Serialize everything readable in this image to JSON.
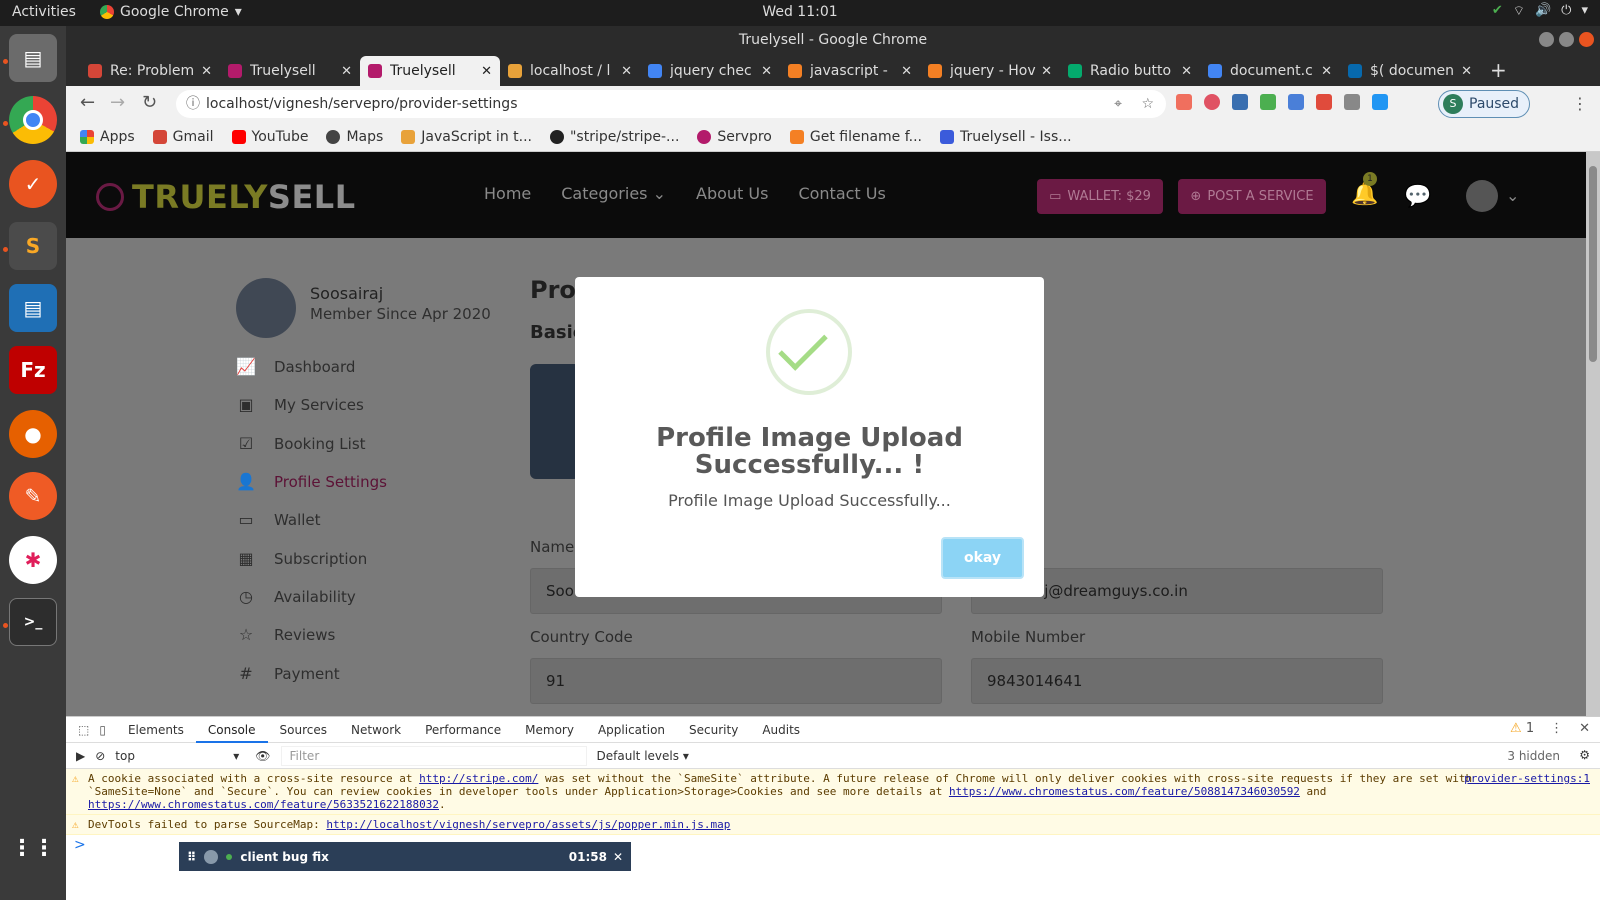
{
  "system": {
    "activities": "Activities",
    "app_menu": "Google Chrome",
    "clock": "Wed 11:01"
  },
  "window": {
    "title": "Truelysell - Google Chrome"
  },
  "tabs": [
    {
      "label": "Re: Problem",
      "color": "#d44638"
    },
    {
      "label": "Truelysell",
      "color": "#b31b6b"
    },
    {
      "label": "Truelysell",
      "color": "#b31b6b"
    },
    {
      "label": "localhost / l",
      "color": "#e8a23a"
    },
    {
      "label": "jquery chec",
      "color": "#4285f4"
    },
    {
      "label": "javascript -",
      "color": "#f48024"
    },
    {
      "label": "jquery - Hov",
      "color": "#f48024"
    },
    {
      "label": "Radio butto",
      "color": "#04aa6d"
    },
    {
      "label": "document.c",
      "color": "#4285f4"
    },
    {
      "label": "$( documen",
      "color": "#0769ad"
    }
  ],
  "address": {
    "url": "localhost/vignesh/servepro/provider-settings",
    "profile_initial": "S",
    "profile_status": "Paused"
  },
  "bookmarks": [
    {
      "label": "Apps",
      "color": "#e94235"
    },
    {
      "label": "Gmail",
      "color": "#d44638"
    },
    {
      "label": "YouTube",
      "color": "#ff0000"
    },
    {
      "label": "Maps",
      "color": "#444"
    },
    {
      "label": "JavaScript in t...",
      "color": "#e8a23a"
    },
    {
      "label": "\"stripe/stripe-...",
      "color": "#222"
    },
    {
      "label": "Servpro",
      "color": "#b31b6b"
    },
    {
      "label": "Get filename f...",
      "color": "#f48024"
    },
    {
      "label": "Truelysell - Iss...",
      "color": "#3b5bdb"
    }
  ],
  "site": {
    "logo_a": "TRUELY",
    "logo_b": "SELL",
    "nav": [
      "Home",
      "Categories",
      "About Us",
      "Contact Us"
    ],
    "wallet": "WALLET: $29",
    "post": "POST A SERVICE",
    "notif_count": "1"
  },
  "profile": {
    "name": "Soosairaj",
    "since": "Member Since Apr 2020",
    "title": "Prof",
    "subtitle": "Basic"
  },
  "sidebar": [
    {
      "label": "Dashboard",
      "icon": "chart-icon",
      "glyph": "📈"
    },
    {
      "label": "My Services",
      "icon": "services-icon",
      "glyph": "▣"
    },
    {
      "label": "Booking List",
      "icon": "calendar-check-icon",
      "glyph": "☑"
    },
    {
      "label": "Profile Settings",
      "icon": "user-icon",
      "glyph": "👤"
    },
    {
      "label": "Wallet",
      "icon": "wallet-icon",
      "glyph": "▭"
    },
    {
      "label": "Subscription",
      "icon": "calendar-icon",
      "glyph": "▦"
    },
    {
      "label": "Availability",
      "icon": "clock-icon",
      "glyph": "◷"
    },
    {
      "label": "Reviews",
      "icon": "star-icon",
      "glyph": "☆"
    },
    {
      "label": "Payment",
      "icon": "hash-icon",
      "glyph": "#"
    }
  ],
  "form": {
    "name_label": "Name",
    "name_value": "Soo",
    "email_value": "aj@dreamguys.co.in",
    "country_label": "Country Code",
    "country_value": "91",
    "mobile_label": "Mobile Number",
    "mobile_value": "9843014641"
  },
  "modal": {
    "title": "Profile Image Upload Successfully... !",
    "text": "Profile Image Upload Successfully...",
    "button": "okay"
  },
  "devtools": {
    "tabs": [
      "Elements",
      "Console",
      "Sources",
      "Network",
      "Performance",
      "Memory",
      "Application",
      "Security",
      "Audits"
    ],
    "active_tab": "Console",
    "warnings_count": "1",
    "context": "top",
    "filter_placeholder": "Filter",
    "levels": "Default levels",
    "hidden": "3 hidden",
    "msg1_a": "A cookie associated with a cross-site resource at ",
    "msg1_link": "http://stripe.com/",
    "msg1_b": " was set without the `SameSite` attribute. A future release of Chrome will only deliver cookies with cross-site requests if they are set with `SameSite=None` and `Secure`. You can review cookies in developer tools under Application>Storage>Cookies and see more details at ",
    "msg1_link2": "https://www.chromestatus.com/feature/5088147346030592",
    "msg1_c": " and ",
    "msg1_link3": "https://www.chromestatus.com/feature/5633521622188032",
    "msg1_d": ".",
    "msg1_src": "provider-settings:1",
    "msg2_a": "DevTools failed to parse SourceMap: ",
    "msg2_link": "http://localhost/vignesh/servepro/assets/js/popper.min.js.map",
    "prompt": ">"
  },
  "timer": {
    "label": "client bug fix",
    "time": "01:58"
  }
}
